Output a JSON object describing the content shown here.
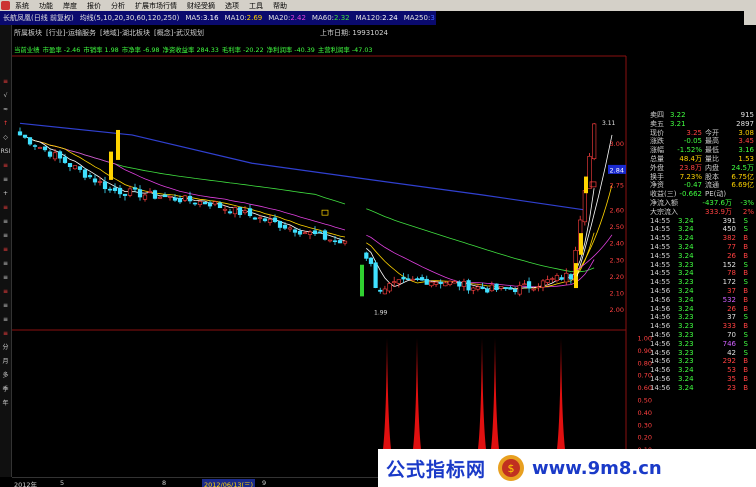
{
  "menu": {
    "items": [
      "系统",
      "功能",
      "岸度",
      "报价",
      "分析",
      "扩展市场行情",
      "财经受摘",
      "选项",
      "工具",
      "帮助"
    ]
  },
  "title": {
    "stock": "长航凤凰(日线 前复权)",
    "ma_label": "均线(5,10,20,30,60,120,250)",
    "ma5_lbl": "MA5:",
    "ma5": "3.16",
    "ma10_lbl": "MA10:",
    "ma10": "2.69",
    "ma20_lbl": "MA20:",
    "ma20": "2.42",
    "ma60_lbl": "MA60:",
    "ma60": "2.32",
    "ma120_lbl": "MA120:",
    "ma120": "2.24",
    "ma250_lbl": "MA250:",
    "ma250": "3"
  },
  "info": {
    "sector": "所属板块",
    "tags": [
      "[行业]-运输服务",
      "[地域]-湖北板块",
      "[概念]-武汉规划"
    ],
    "listing_label": "上市日期:",
    "listing_date": "19931024"
  },
  "fund": {
    "items": [
      "当前业绩",
      "市盈率 -2.46",
      "市销率 1.98",
      "市净率 -6.98",
      "净资收益率 284.33",
      "毛利率 -20.22",
      "净利润率 -40.39",
      "主营利润率 -47.03"
    ]
  },
  "leftbar": {
    "items": [
      "≡",
      "√",
      "≈",
      "↑",
      "◇",
      "RSI",
      "≡",
      "≡",
      "+",
      "≡",
      "≡",
      "≡",
      "≡",
      "≡",
      "≡",
      "≡",
      "≡",
      "≡",
      "≡",
      "分",
      "月",
      "多",
      "季",
      "年"
    ]
  },
  "axis": {
    "price_ticks": [
      "3.00",
      "2.84",
      "2.75",
      "2.60",
      "2.50",
      "2.40",
      "2.30",
      "2.20",
      "2.10",
      "2.00"
    ],
    "current_price_tag": "2.84",
    "top_label": "3.11",
    "low_label": "1.99",
    "ind_ticks": [
      "1.00",
      "0.90",
      "0.80",
      "0.70",
      "0.60",
      "0.50",
      "0.40",
      "0.30",
      "0.20",
      "0.10",
      "0.00"
    ]
  },
  "quotes": {
    "ask4": {
      "label": "卖四",
      "price": "3.22",
      "vol": "915"
    },
    "ask5": {
      "label": "卖五",
      "price": "3.21",
      "vol": "2897"
    }
  },
  "stats": [
    {
      "l1": "现价",
      "v1": "3.25",
      "l2": "今开",
      "v2": "3.08"
    },
    {
      "l1": "涨跌",
      "v1": "-0.05",
      "l2": "最高",
      "v2": "3.45"
    },
    {
      "l1": "涨幅",
      "v1": "-1.52%",
      "l2": "最低",
      "v2": "3.16"
    },
    {
      "l1": "总量",
      "v1": "48.4万",
      "l2": "量比",
      "v2": "1.53"
    },
    {
      "l1": "外盘",
      "v1": "23.8万",
      "l2": "内盘",
      "v2": "24.5万"
    },
    {
      "l1": "换手",
      "v1": "7.23%",
      "l2": "股本",
      "v2": "6.75亿"
    },
    {
      "l1": "净资",
      "v1": "-0.47",
      "l2": "流通",
      "v2": "6.69亿"
    },
    {
      "l1": "收益(三)",
      "v1": "-0.662",
      "l2": "PE(动)",
      "v2": ""
    }
  ],
  "flows": [
    {
      "label": "净流入额",
      "value": "-437.6万",
      "pct": "-3%"
    },
    {
      "label": "大宗流入",
      "value": "333.9万",
      "pct": "2%"
    }
  ],
  "ticks": [
    {
      "time": "14:55",
      "price": "3.24",
      "vol": "391",
      "dir": "S"
    },
    {
      "time": "14:55",
      "price": "3.24",
      "vol": "450",
      "dir": "S"
    },
    {
      "time": "14:55",
      "price": "3.24",
      "vol": "382",
      "dir": "B"
    },
    {
      "time": "14:55",
      "price": "3.24",
      "vol": "77",
      "dir": "B"
    },
    {
      "time": "14:55",
      "price": "3.24",
      "vol": "26",
      "dir": "B"
    },
    {
      "time": "14:55",
      "price": "3.23",
      "vol": "152",
      "dir": "S"
    },
    {
      "time": "14:55",
      "price": "3.24",
      "vol": "78",
      "dir": "B"
    },
    {
      "time": "14:55",
      "price": "3.23",
      "vol": "172",
      "dir": "S"
    },
    {
      "time": "14:56",
      "price": "3.24",
      "vol": "37",
      "dir": "B"
    },
    {
      "time": "14:56",
      "price": "3.24",
      "vol": "532",
      "dir": "B"
    },
    {
      "time": "14:56",
      "price": "3.24",
      "vol": "26",
      "dir": "B"
    },
    {
      "time": "14:56",
      "price": "3.23",
      "vol": "37",
      "dir": "S"
    },
    {
      "time": "14:56",
      "price": "3.23",
      "vol": "333",
      "dir": "B"
    },
    {
      "time": "14:56",
      "price": "3.23",
      "vol": "70",
      "dir": "S"
    },
    {
      "time": "14:56",
      "price": "3.23",
      "vol": "746",
      "dir": "S"
    },
    {
      "time": "14:56",
      "price": "3.23",
      "vol": "42",
      "dir": "S"
    },
    {
      "time": "14:56",
      "price": "3.23",
      "vol": "292",
      "dir": "B"
    },
    {
      "time": "14:56",
      "price": "3.24",
      "vol": "53",
      "dir": "B"
    },
    {
      "time": "14:56",
      "price": "3.24",
      "vol": "35",
      "dir": "B"
    },
    {
      "time": "14:56",
      "price": "3.24",
      "vol": "23",
      "dir": "B"
    }
  ],
  "timeaxis": {
    "labels": [
      "2012年",
      "5",
      "8",
      "2012/06/13(三)",
      "9",
      "11"
    ]
  },
  "watermark": {
    "text": "公式指标网",
    "url": "www.9m8.cn"
  },
  "colors": {
    "up": "#ff4040",
    "down": "#40e0ff",
    "yang": "#ffd400",
    "ma5": "#ffffff",
    "ma10": "#ffd400",
    "ma20": "#e040e0",
    "ma60": "#40e040",
    "ma250": "#3040d0"
  }
}
